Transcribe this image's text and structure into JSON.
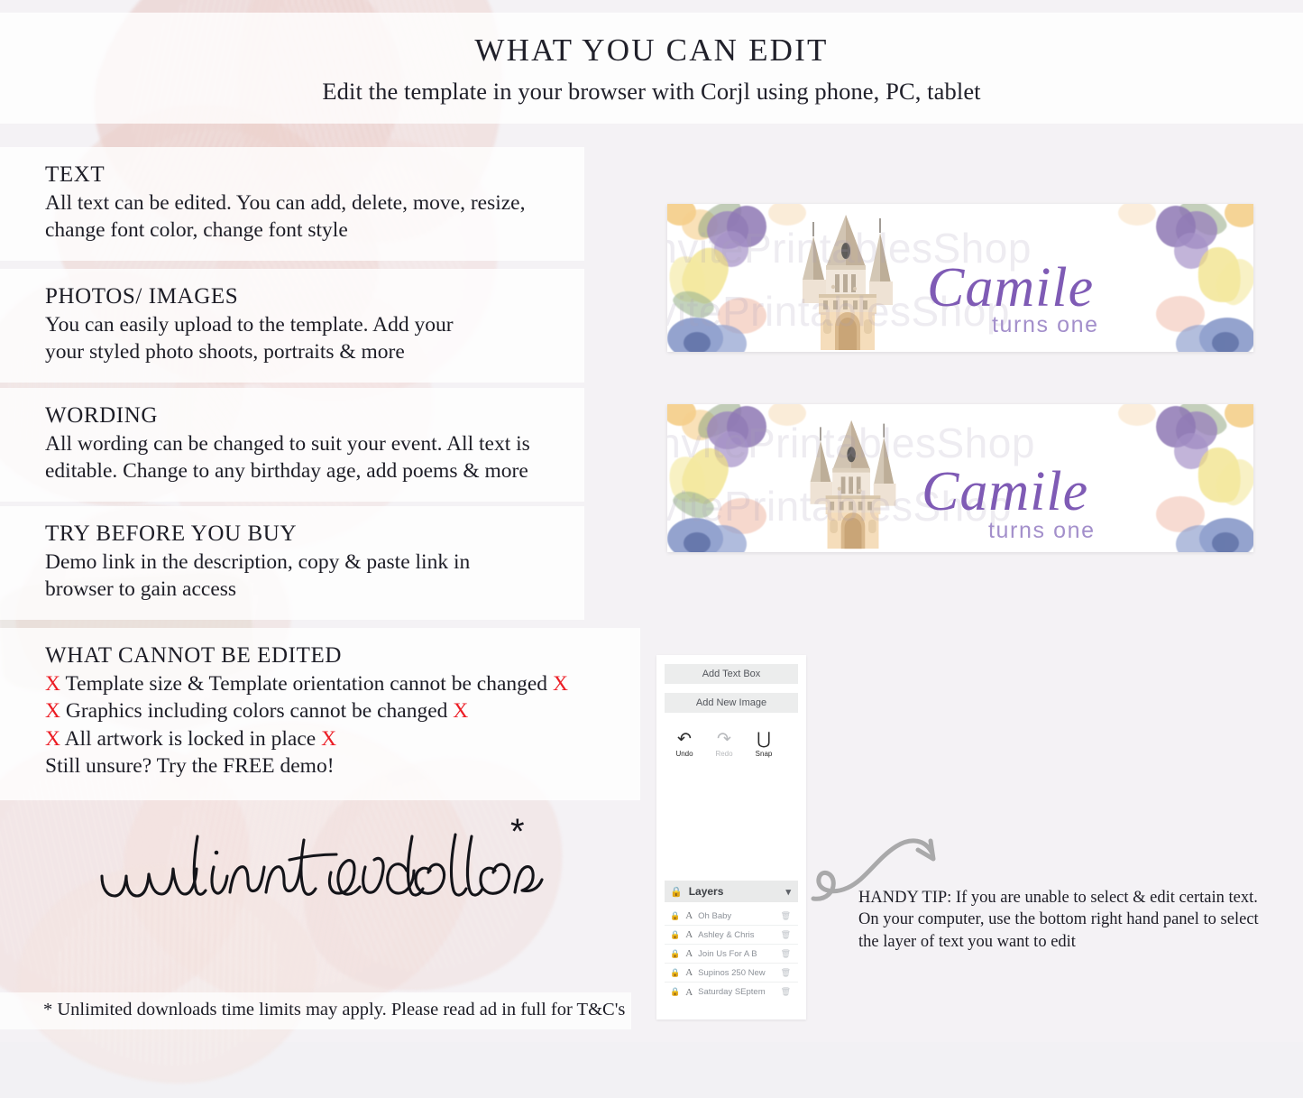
{
  "header": {
    "title": "WHAT YOU CAN EDIT",
    "subtitle": "Edit the template in your browser with Corjl using phone, PC, tablet"
  },
  "info_sections": [
    {
      "title": "TEXT",
      "lines": [
        "All text can be edited. You can add, delete, move, resize,",
        "change font color, change font style"
      ]
    },
    {
      "title": "PHOTOS/ IMAGES",
      "lines": [
        "You can easily upload to the template. Add your",
        "your styled photo shoots, portraits & more"
      ]
    },
    {
      "title": "WORDING",
      "lines": [
        "All wording can be changed to suit your event. All text is",
        "editable. Change to any birthday age, add poems & more"
      ]
    },
    {
      "title": "TRY BEFORE YOU BUY",
      "lines": [
        "Demo link in the description, copy & paste link in",
        "browser to gain access"
      ]
    }
  ],
  "cannot_edit": {
    "title": "WHAT CANNOT BE EDITED",
    "x_mark": "X",
    "items": [
      "Template size & Template orientation cannot be changed",
      "Graphics including colors cannot be changed",
      "All artwork is locked in place"
    ],
    "closing_line": "Still unsure? Try the FREE demo!"
  },
  "promo": {
    "script_text": "unlimited downloads",
    "asterisk": "*",
    "footnote": "* Unlimited downloads time limits may apply. Please read ad in full for T&C's"
  },
  "banners": [
    {
      "name": "Camile",
      "subtitle": "turns one",
      "watermark": "InvitePrintablesShop",
      "name_color": "#7f5bb5",
      "subtitle_color": "#a38fcb"
    },
    {
      "name": "Camile",
      "subtitle": "turns one",
      "watermark": "InvitePrintablesShop",
      "name_color": "#7f5bb5",
      "subtitle_color": "#a38fcb"
    }
  ],
  "editor": {
    "add_text_box": "Add Text Box",
    "add_new_image": "Add New Image",
    "tools": [
      {
        "label": "Undo",
        "icon": "undo-arrow",
        "glyph": "↶",
        "enabled": true
      },
      {
        "label": "Redo",
        "icon": "redo-arrow",
        "glyph": "↷",
        "enabled": false
      },
      {
        "label": "Snap",
        "icon": "magnet",
        "glyph": "∪",
        "enabled": true
      }
    ],
    "layers_label": "Layers",
    "layers": [
      {
        "name": "Oh Baby"
      },
      {
        "name": "Ashley & Chris"
      },
      {
        "name": "Join Us For A B"
      },
      {
        "name": "Supinos 250 New"
      },
      {
        "name": "Saturday SEptem"
      }
    ]
  },
  "handy_tip": {
    "lines": [
      "HANDY TIP: If you are unable to select & edit certain text.",
      "On your computer, use the bottom right hand panel to select",
      "the layer of text you want to edit"
    ]
  }
}
